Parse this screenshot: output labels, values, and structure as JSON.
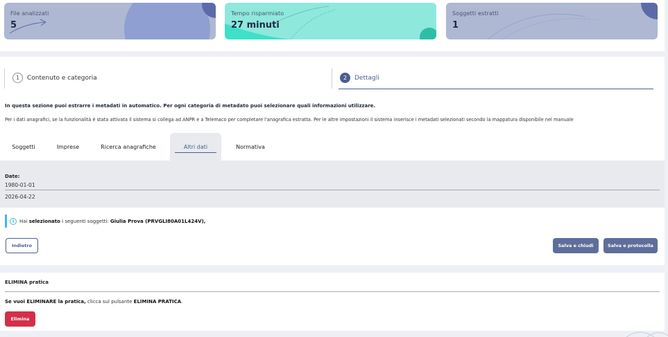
{
  "stats": {
    "files": {
      "label": "File analizzati",
      "value": "5"
    },
    "time": {
      "label": "Tempo risparmiato",
      "value": "27 minuti"
    },
    "subjects": {
      "label": "Soggetti estratti",
      "value": "1"
    }
  },
  "steps": [
    {
      "number": "1",
      "label": "Contenuto e categoria"
    },
    {
      "number": "2",
      "label": "Dettagli"
    }
  ],
  "intro": "In questa sezione puoi estrarre i metadati in automatico. Per ogni categoria di metadato puoi selezionare quali informazioni utilizzare.",
  "note": "Per i dati anagrafici, se la funzionalità è stata attivata il sistema si collega ad ANPR e a Telemaco per completare l'anagrafica estratta. Per le altre impostazioni il sistema inserisce i metadati selezionati secondo la mappatura disponibile nel manuale",
  "tabs": [
    {
      "label": "Soggetti"
    },
    {
      "label": "Imprese"
    },
    {
      "label": "Ricerca anagrafiche"
    },
    {
      "label": "Altri dati"
    },
    {
      "label": "Normativa"
    }
  ],
  "active_tab": "Altri dati",
  "dates": {
    "label": "Date:",
    "values": [
      "1980-01-01",
      "2026-04-22"
    ]
  },
  "info": {
    "prefix": "Hai",
    "bold": "selezionato",
    "middle": "i seguenti soggetti:",
    "subject": "Giulia Prova (PRVGLI80A01L424V),"
  },
  "buttons": {
    "back": "Indietro",
    "save_close": "Salva e chiudi",
    "save_protocol": "Salva e protocolla"
  },
  "delete": {
    "title": "ELIMINA pratica",
    "text_bold": "Se vuoi ELIMINARE la pratica,",
    "text_middle": "clicca sul pulsante",
    "text_bold2": "ELIMINA PRATICA",
    "text_end": ".",
    "button": "Elimina"
  },
  "colors": {
    "accent": "#4b5e8e",
    "danger": "#d32f4a",
    "info": "#43b7e6",
    "card_blue": "#aeb8d3",
    "card_teal": "#8ee8dc"
  }
}
